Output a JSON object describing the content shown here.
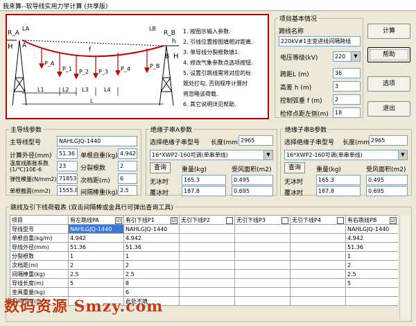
{
  "window": {
    "title": "我来算--软导线实用力学计算 (共享版)"
  },
  "diagram": {
    "labels": {
      "ra": "R_A",
      "rb": "R_B",
      "la": "LA",
      "lb": "LB",
      "h_left": "H",
      "a": "A",
      "h_right": "H",
      "b": "B",
      "h_small": "h",
      "f": "f",
      "pa": "P_A",
      "p1": "P_1",
      "p2": "P_2",
      "p3": "P_3",
      "p4": "P_4",
      "pb": "P_B",
      "l1": "L1",
      "l2": "L2",
      "l3": "L3",
      "l4": "L4",
      "l": "L"
    },
    "steps": [
      "1. 按图示输入参数.",
      "2. 引线位置按图填相对距离.",
      "3. 单导线分裂根数填1.",
      "4. 修改气象参数点选项按钮.",
      "5. 设置引跳线需将对应的标",
      "题处打勾, 否则程序计算时",
      "将忽略该荷载.",
      "6. 其它说明详见帮助."
    ]
  },
  "project": {
    "legend": "项目基本情况",
    "span_name_label": "跨线名称",
    "span_name_value": "220kV#1主变进线间隔跨线",
    "voltage_label": "电压等级(kV)",
    "voltage_value": "220",
    "span_label": "跨距L (m)",
    "span_value": "36",
    "height_label": "高差 h (m)",
    "height_value": "3",
    "sag_label": "控制弧垂 f (m)",
    "sag_value": "2",
    "check_label": "检修点距左侧(m)",
    "check_value": "18"
  },
  "buttons": {
    "calculate": "计算",
    "help": "帮助",
    "options": "选项",
    "exit": "退出"
  },
  "conductor": {
    "legend": "主导线参数",
    "model_label": "主导线型号",
    "model_value": "NAHLGJQ-1440",
    "diameter_label": "计算外径(mm)",
    "diameter_value": "51.36",
    "weight_label": "单根自重(kg)",
    "weight_value": "4.942",
    "thermal_label": "温度线膨胀系数",
    "thermal_label2": "(1/℃)10E-6",
    "thermal_value": "23",
    "split_label": "分裂根数",
    "split_value": "2",
    "modulus_label": "弹性模量(N/mm2)",
    "modulus_value": "71853",
    "subspan_label": "次档距(m)",
    "subspan_value": "6",
    "area_label": "单根截面(mm2)",
    "area_value": "1555.8",
    "spacer_label": "间隔棒重(kg)",
    "spacer_value": "2.5"
  },
  "insulator_a": {
    "legend": "绝缘子串A参数",
    "model_label": "选择绝缘子串型号",
    "length_label": "长度(mm)",
    "length_value": "2965",
    "select_value": "16*XWP2-160可调(单串单线)",
    "query": "查询",
    "weight_label": "重量(kg)",
    "wind_label": "受风面积(m2)",
    "no_ice_label": "无冰时",
    "no_ice_weight": "165.3",
    "no_ice_wind": "0.495",
    "ice_label": "覆冰时",
    "ice_weight": "187.8",
    "ice_wind": "0.695"
  },
  "insulator_b": {
    "legend": "绝缘子串B参数",
    "model_label": "选择绝缘子串型号",
    "length_label": "长度(mm)",
    "length_value": "2965",
    "select_value": "16*XWP2-160可调(单串单线)",
    "query": "查询",
    "weight_label": "重量(kg)",
    "wind_label": "受风面积(m2)",
    "no_ice_label": "无冰时",
    "no_ice_weight": "165.3",
    "no_ice_wind": "0.495",
    "ice_label": "覆冰时",
    "ice_weight": "187.8",
    "ice_wind": "0.695"
  },
  "loads": {
    "legend": "跳线及引下线荷载表 (双击间隔棒或金具行可弹出查询工具)",
    "headers": [
      "项目",
      "有左跳线PA",
      "有引下线P1",
      "无引下线P2",
      "无引下线P3",
      "无引下线P4",
      "有右跳线PB"
    ],
    "checked": [
      "",
      "☑",
      "☑",
      "",
      "",
      "",
      "☑"
    ],
    "rows": [
      [
        "导线型号",
        "NAHLGJQ-1440",
        "NAHLGJQ-1440",
        "",
        "",
        "",
        "NAHLGJQ-1440"
      ],
      [
        "单根自重(kg/m)",
        "4.942",
        "4.942",
        "",
        "",
        "",
        "4.942"
      ],
      [
        "导线外径(mm)",
        "51.36",
        "51.36",
        "",
        "",
        "",
        "51.36"
      ],
      [
        "分裂根数",
        "1",
        "1",
        "",
        "",
        "",
        "1"
      ],
      [
        "次档距(m)",
        "2",
        "2",
        "",
        "",
        "",
        "2"
      ],
      [
        "间隔棒重(kg)",
        "2.5",
        "2.5",
        "",
        "",
        "",
        "2.5"
      ],
      [
        "导线长度(m)",
        "5",
        "8",
        "",
        "",
        "",
        "5"
      ],
      [
        "金具重量(kg)",
        "",
        "6",
        "",
        "",
        "",
        ""
      ],
      [
        "相间距离(m)",
        "",
        "此处不填",
        "",
        "",
        "",
        ""
      ]
    ]
  },
  "watermark": "数码资源 Smzy.com"
}
